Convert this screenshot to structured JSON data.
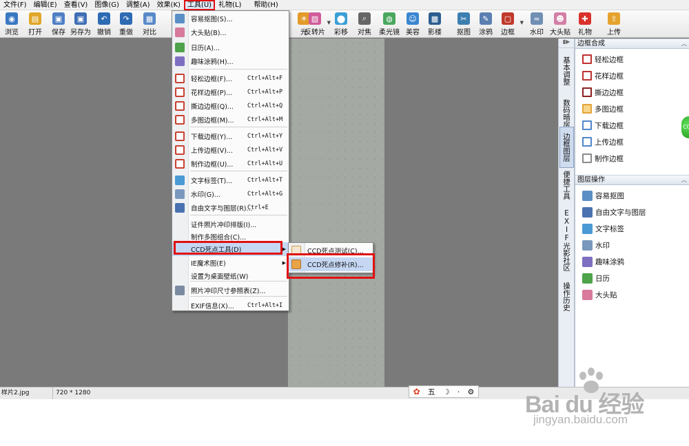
{
  "menubar": [
    {
      "label": "文件(F)"
    },
    {
      "label": "编辑(E)"
    },
    {
      "label": "查看(V)"
    },
    {
      "label": "图像(G)"
    },
    {
      "label": "调整(A)"
    },
    {
      "label": "效果(K)"
    },
    {
      "label": "工具(U)"
    },
    {
      "label": "礼物(L)"
    },
    {
      "label": "帮助(H)"
    }
  ],
  "toolbar": [
    {
      "label": "浏览",
      "icon": "browse-icon",
      "color": "#3a78c2"
    },
    {
      "label": "打开",
      "icon": "folder-open-icon",
      "color": "#e0a628"
    },
    {
      "label": "保存",
      "icon": "save-icon",
      "color": "#4f7fc4"
    },
    {
      "label": "另存为",
      "icon": "save-as-icon",
      "color": "#3f6fb5"
    },
    {
      "label": "撤销",
      "icon": "undo-icon",
      "color": "#2d6bb3"
    },
    {
      "label": "重做",
      "icon": "redo-icon",
      "color": "#2d6bb3"
    },
    {
      "label": "对比",
      "icon": "compare-icon",
      "color": "#5889c8"
    },
    {
      "label": "光",
      "icon": "light-icon",
      "color": "#e39a2a"
    },
    {
      "label": "反转片",
      "icon": "reversal-film-icon",
      "color": "#d05c9a"
    },
    {
      "label": "彩移",
      "icon": "color-shift-icon",
      "color": "#3aa0d6"
    },
    {
      "label": "对焦",
      "icon": "focus-icon",
      "color": "#666666"
    },
    {
      "label": "柔光镜",
      "icon": "soft-light-icon",
      "color": "#4aa75e"
    },
    {
      "label": "美容",
      "icon": "beauty-icon",
      "color": "#3a86d0"
    },
    {
      "label": "影楼",
      "icon": "studio-icon",
      "color": "#2c5d8f"
    },
    {
      "label": "抠图",
      "icon": "cutout-icon",
      "color": "#3c7fb1"
    },
    {
      "label": "涂鸦",
      "icon": "graffiti-icon",
      "color": "#5a7fb0"
    },
    {
      "label": "边框",
      "icon": "border-icon",
      "color": "#c0392b"
    },
    {
      "label": "水印",
      "icon": "watermark-icon",
      "color": "#6f8fb4"
    },
    {
      "label": "大头贴",
      "icon": "sticker-icon",
      "color": "#d47fa6"
    },
    {
      "label": "礼物",
      "icon": "gift-icon",
      "color": "#d9312b"
    },
    {
      "label": "上传",
      "icon": "upload-icon",
      "color": "#e5a32d"
    }
  ],
  "tools_menu": {
    "items": [
      {
        "label": "容易抠图(S)...",
        "shortcut": "",
        "icon": "easy-cutout-icon",
        "color": "#5a8fc6"
      },
      {
        "label": "大头贴(B)...",
        "shortcut": "",
        "icon": "sticker-icon",
        "color": "#d77a9c"
      },
      {
        "label": "日历(A)...",
        "shortcut": "",
        "icon": "calendar-icon",
        "color": "#4ea34b"
      },
      {
        "label": "趣味涂鸦(H)...",
        "shortcut": "",
        "icon": "fun-graffiti-icon",
        "color": "#7e6fc1"
      },
      {
        "label": "轻松边框(F)...",
        "shortcut": "Ctrl+Alt+F",
        "icon": "easy-border-icon",
        "color": "#c84030"
      },
      {
        "label": "花样边框(P)...",
        "shortcut": "Ctrl+Alt+P",
        "icon": "pattern-border-icon",
        "color": "#c84030"
      },
      {
        "label": "撕边边框(Q)...",
        "shortcut": "Ctrl+Alt+Q",
        "icon": "torn-border-icon",
        "color": "#9c2a2a"
      },
      {
        "label": "多图边框(M)...",
        "shortcut": "Ctrl+Alt+M",
        "icon": "multi-image-border-icon",
        "color": "#e3a43a"
      },
      {
        "label": "下载边框(Y)...",
        "shortcut": "Ctrl+Alt+Y",
        "icon": "download-border-icon",
        "color": "#4f86c9"
      },
      {
        "label": "上传边框(V)...",
        "shortcut": "Ctrl+Alt+V",
        "icon": "upload-border-icon",
        "color": "#4f86c9"
      },
      {
        "label": "制作边框(U)...",
        "shortcut": "Ctrl+Alt+U",
        "icon": "make-border-icon",
        "color": "#8a8a8a"
      },
      {
        "label": "文字标签(T)...",
        "shortcut": "Ctrl+Alt+T",
        "icon": "text-tag-icon",
        "color": "#4a9ad4"
      },
      {
        "label": "水印(G)...",
        "shortcut": "Ctrl+Alt+G",
        "icon": "watermark-icon",
        "color": "#7a98bd"
      },
      {
        "label": "自由文字与图层(R)...",
        "shortcut": "Ctrl+E",
        "icon": "free-text-layer-icon",
        "color": "#4a72b0"
      },
      {
        "label": "证件照片冲印排版(I)...",
        "shortcut": "",
        "icon": "",
        "color": ""
      },
      {
        "label": "制作多图组合(C)...",
        "shortcut": "",
        "icon": "",
        "color": ""
      },
      {
        "label": "CCD死点工具(D)",
        "shortcut": "",
        "icon": "",
        "color": "",
        "submenu": true
      },
      {
        "label": "IE魔术图(E)",
        "shortcut": "",
        "icon": "",
        "color": "",
        "submenu": true
      },
      {
        "label": "设置为桌面壁纸(W)",
        "shortcut": "",
        "icon": "",
        "color": ""
      },
      {
        "label": "照片冲印尺寸参照表(Z)...",
        "shortcut": "",
        "icon": "photo-size-table-icon",
        "color": "#7a8aa0"
      },
      {
        "label": "EXIF信息(X)...",
        "shortcut": "Ctrl+Alt+I",
        "icon": "",
        "color": ""
      }
    ]
  },
  "ccd_submenu": [
    {
      "label": "CCD死点测试(C)...",
      "icon": "ccd-test-icon"
    },
    {
      "label": "CCD死点修补(R)...",
      "icon": "ccd-repair-icon"
    }
  ],
  "side_tabs": [
    {
      "label": "基本调整"
    },
    {
      "label": "数码暗房"
    },
    {
      "label": "边框图层"
    },
    {
      "label": "便捷工具"
    },
    {
      "label": "EXIF"
    },
    {
      "label": "光影社区"
    },
    {
      "label": "操作历史"
    }
  ],
  "border_panel": {
    "title": "边框合成",
    "items": [
      {
        "label": "轻松边框"
      },
      {
        "label": "花样边框"
      },
      {
        "label": "撕边边框"
      },
      {
        "label": "多图边框"
      },
      {
        "label": "下载边框"
      },
      {
        "label": "上传边框"
      },
      {
        "label": "制作边框"
      }
    ]
  },
  "layer_panel": {
    "title": "图层操作",
    "items": [
      {
        "label": "容易抠图",
        "icon": "easy-cutout-icon",
        "color": "#5a8fc6"
      },
      {
        "label": "自由文字与图层",
        "icon": "free-text-layer-icon",
        "color": "#4a72b0"
      },
      {
        "label": "文字标签",
        "icon": "text-tag-icon",
        "color": "#4a9ad4"
      },
      {
        "label": "水印",
        "icon": "watermark-icon",
        "color": "#7a98bd"
      },
      {
        "label": "趣味涂鸦",
        "icon": "fun-graffiti-icon",
        "color": "#7e6fc1"
      },
      {
        "label": "日历",
        "icon": "calendar-icon",
        "color": "#4ea34b"
      },
      {
        "label": "大头贴",
        "icon": "sticker-icon",
        "color": "#d77a9c"
      }
    ]
  },
  "status": {
    "filename": "样片2.jpg",
    "dimensions": "720 * 1280"
  },
  "ime": {
    "five": "五",
    "moon": "☽",
    "dot": "·"
  },
  "watermark": {
    "text": "Bai du 经验",
    "url": "jingyan.baidu.com"
  },
  "colors": {
    "highlight_box": "#e01010",
    "menu_highlight": "#c5d7f3"
  }
}
